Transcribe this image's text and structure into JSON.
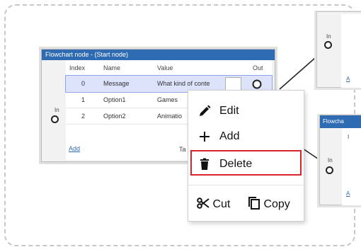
{
  "node": {
    "title": "Flowchart node - (Start node)",
    "columns": {
      "index": "Index",
      "name": "Name",
      "value": "Value",
      "out": "Out"
    },
    "rows": [
      {
        "index": "0",
        "name": "Message",
        "value": "What kind of conte"
      },
      {
        "index": "1",
        "name": "Option1",
        "value": "Games"
      },
      {
        "index": "2",
        "name": "Option2",
        "value": "Animatio"
      }
    ],
    "in_label": "In",
    "add_link": "Add",
    "truncated_text": "Ta"
  },
  "right_nodes": {
    "node1": {
      "in_label": "In",
      "link": "A"
    },
    "node2": {
      "title": "Flowcha",
      "col_fragment": "I",
      "in_label": "In",
      "link": "A"
    }
  },
  "context_menu": {
    "items": [
      {
        "label": "Edit",
        "icon": "pencil-icon"
      },
      {
        "label": "Add",
        "icon": "plus-icon"
      },
      {
        "label": "Delete",
        "icon": "trash-icon",
        "highlighted": true
      }
    ],
    "cut_label": "Cut",
    "copy_label": "Copy",
    "highlight_color": "#d8232a"
  },
  "colors": {
    "node_title_bg": "#2e6bb3",
    "selected_row_bg": "#dde3fb"
  }
}
